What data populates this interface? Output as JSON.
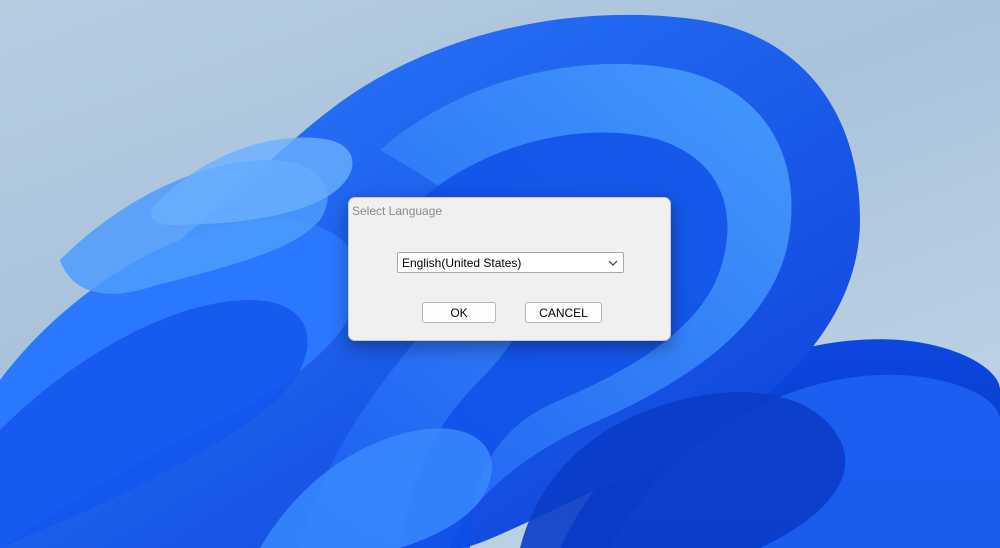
{
  "dialog": {
    "title": "Select Language",
    "language_select": {
      "selected": "English(United States)",
      "icon": "chevron-down-icon"
    },
    "ok_label": "OK",
    "cancel_label": "CANCEL"
  },
  "colors": {
    "dialog_background": "#f0f0f0",
    "title_text": "#8a8a8a",
    "wallpaper_blue": "#1a5cf0",
    "wallpaper_sky": "#b7cde0"
  }
}
